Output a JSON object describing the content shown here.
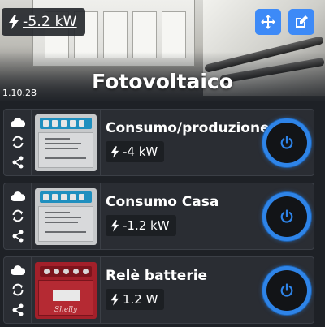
{
  "header": {
    "power_value": "-5.2 kW",
    "version": "1.10.28",
    "title": "Fotovoltaico",
    "move_icon": "arrows-move-icon",
    "edit_icon": "edit-icon",
    "accent_color": "#3d8af7"
  },
  "devices": [
    {
      "name": "Consumo/produzione",
      "power": "-4 kW",
      "image": "shelly-em-grey",
      "side_icons": [
        "cloud-icon",
        "sync-icon",
        "share-icon"
      ],
      "power_button_icon": "power-icon"
    },
    {
      "name": "Consumo Casa",
      "power": "-1.2 kW",
      "image": "shelly-em-grey",
      "side_icons": [
        "cloud-icon",
        "sync-icon",
        "share-icon"
      ],
      "power_button_icon": "power-icon"
    },
    {
      "name": "Relè batterie",
      "power": "1.2 W",
      "image": "shelly-plus-red",
      "image_logo": "Shelly",
      "side_icons": [
        "cloud-icon",
        "sync-icon",
        "share-icon"
      ],
      "power_button_icon": "power-icon"
    }
  ]
}
